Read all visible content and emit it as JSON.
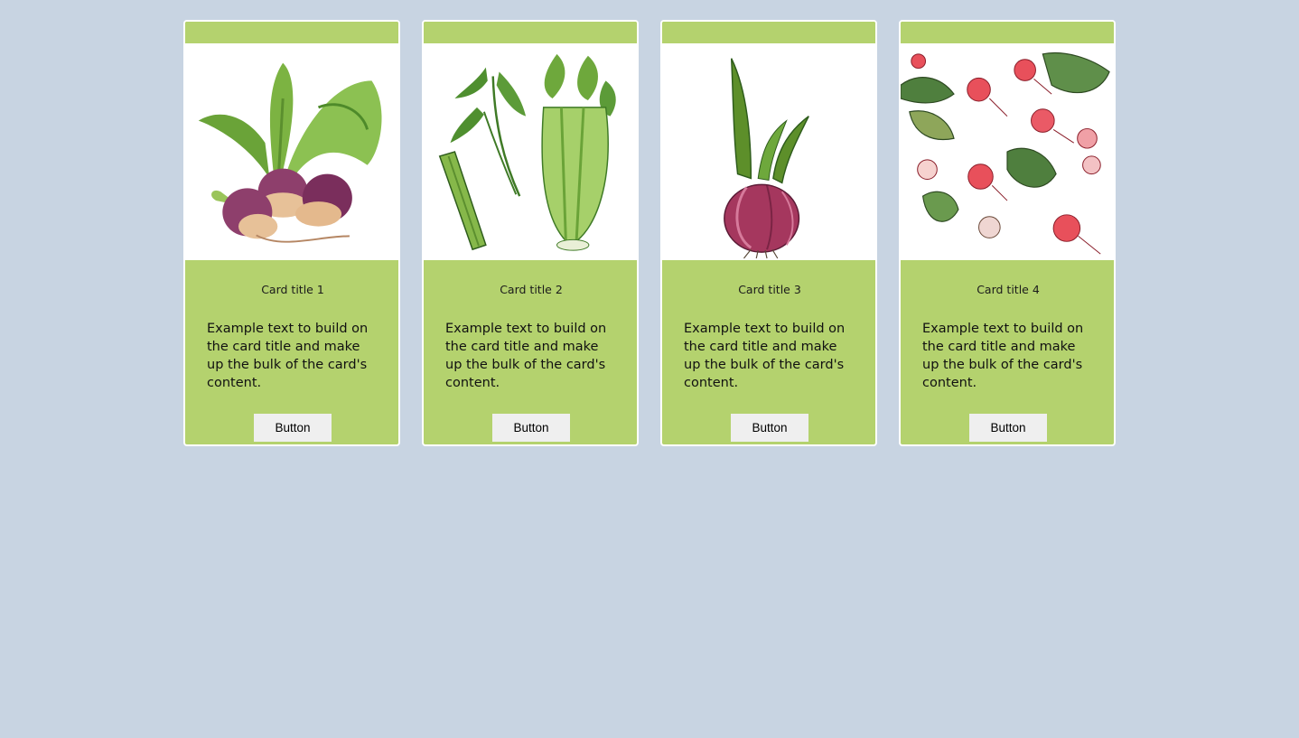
{
  "cards": [
    {
      "title": "Card title 1",
      "text": "Example text to build on the card title and make up the bulk of the card's content.",
      "button_label": "Button",
      "image_icon": "turnip-illustration"
    },
    {
      "title": "Card title 2",
      "text": "Example text to build on the card title and make up the bulk of the card's content.",
      "button_label": "Button",
      "image_icon": "celery-illustration"
    },
    {
      "title": "Card title 3",
      "text": "Example text to build on the card title and make up the bulk of the card's content.",
      "button_label": "Button",
      "image_icon": "onion-illustration"
    },
    {
      "title": "Card title 4",
      "text": "Example text to build on the card title and make up the bulk of the card's content.",
      "button_label": "Button",
      "image_icon": "radish-pattern-illustration"
    }
  ],
  "colors": {
    "page_background": "#c8d4e2",
    "card_background": "#b4d26e",
    "card_border": "#ffffff",
    "button_background": "#efefef"
  }
}
